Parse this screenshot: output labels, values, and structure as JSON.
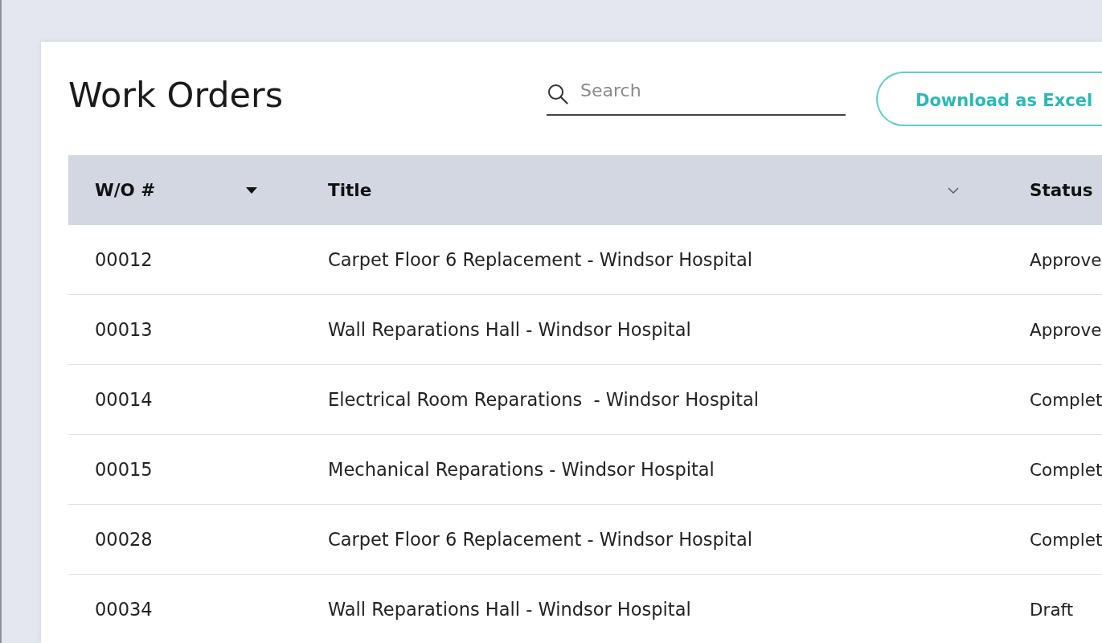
{
  "page": {
    "title": "Work Orders"
  },
  "search": {
    "placeholder": "Search"
  },
  "download_button": {
    "label": "Download as Excel"
  },
  "table": {
    "columns": [
      {
        "label": "W/O #",
        "sorted": true
      },
      {
        "label": "Title",
        "sorted": false
      },
      {
        "label": "Status"
      }
    ],
    "rows": [
      {
        "number": "00012",
        "title": "Carpet Floor 6 Replacement - Windsor Hospital",
        "status": "Approve"
      },
      {
        "number": "00013",
        "title": "Wall Reparations Hall - Windsor Hospital",
        "status": "Approve"
      },
      {
        "number": "00014",
        "title": "Electrical Room Reparations  - Windsor Hospital",
        "status": "Complet"
      },
      {
        "number": "00015",
        "title": "Mechanical Reparations - Windsor Hospital",
        "status": "Complet"
      },
      {
        "number": "00028",
        "title": "Carpet Floor 6 Replacement - Windsor Hospital",
        "status": "Complet"
      },
      {
        "number": "00034",
        "title": "Wall Reparations Hall - Windsor Hospital",
        "status": "Draft"
      }
    ]
  }
}
